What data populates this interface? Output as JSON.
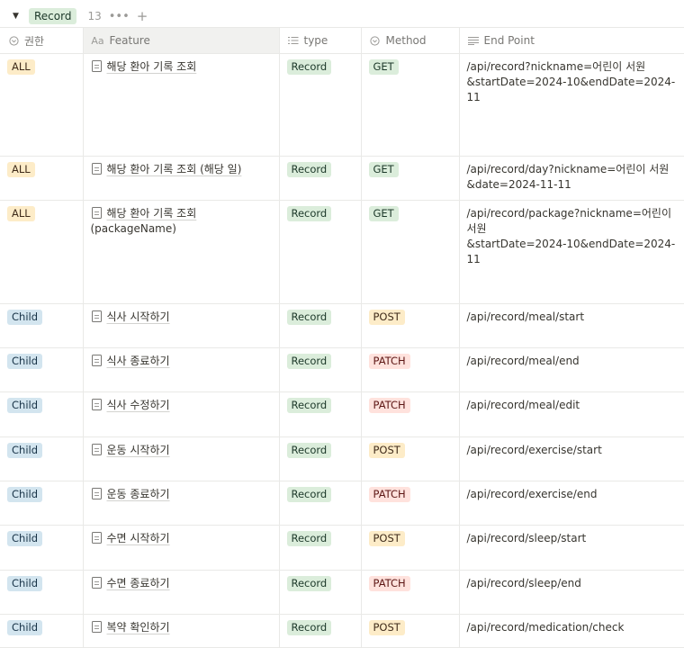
{
  "group": {
    "label": "Record",
    "count": "13"
  },
  "columns": [
    {
      "label": "권한",
      "icon": "circle-chevron-icon"
    },
    {
      "label": "Feature",
      "icon": "title-aa-icon",
      "icon_text": "Aa"
    },
    {
      "label": "type",
      "icon": "list-icon"
    },
    {
      "label": "Method",
      "icon": "circle-chevron-icon"
    },
    {
      "label": "End Point",
      "icon": "text-lines-icon"
    }
  ],
  "rows": [
    {
      "role": "ALL",
      "feature": "해당 환아 기록 조회",
      "type": "Record",
      "method": "GET",
      "endpoint": "/api/record?nickname=어린이 서원\n&startDate=2024-10&endDate=2024-11"
    },
    {
      "role": "ALL",
      "feature": "해당 환아 기록 조회 (해당 일)",
      "type": "Record",
      "method": "GET",
      "endpoint": "/api/record/day?nickname=어린이 서원\n&date=2024-11-11"
    },
    {
      "role": "ALL",
      "feature": "해당 환아 기록 조회",
      "feature_sub": "(packageName)",
      "type": "Record",
      "method": "GET",
      "endpoint": "/api/record/package?nickname=어린이 서원\n&startDate=2024-10&endDate=2024-11"
    },
    {
      "role": "Child",
      "feature": "식사 시작하기",
      "type": "Record",
      "method": "POST",
      "endpoint": "/api/record/meal/start"
    },
    {
      "role": "Child",
      "feature": "식사 종료하기",
      "type": "Record",
      "method": "PATCH",
      "endpoint": "/api/record/meal/end"
    },
    {
      "role": "Child",
      "feature": "식사 수정하기",
      "type": "Record",
      "method": "PATCH",
      "endpoint": "/api/record/meal/edit"
    },
    {
      "role": "Child",
      "feature": "운동 시작하기",
      "type": "Record",
      "method": "POST",
      "endpoint": "/api/record/exercise/start"
    },
    {
      "role": "Child",
      "feature": "운동 종료하기",
      "type": "Record",
      "method": "PATCH",
      "endpoint": "/api/record/exercise/end"
    },
    {
      "role": "Child",
      "feature": "수면 시작하기",
      "type": "Record",
      "method": "POST",
      "endpoint": "/api/record/sleep/start"
    },
    {
      "role": "Child",
      "feature": "수면 종료하기",
      "type": "Record",
      "method": "PATCH",
      "endpoint": "/api/record/sleep/end"
    },
    {
      "role": "Child",
      "feature": "복약 확인하기",
      "type": "Record",
      "method": "POST",
      "endpoint": "/api/record/medication/check"
    }
  ]
}
